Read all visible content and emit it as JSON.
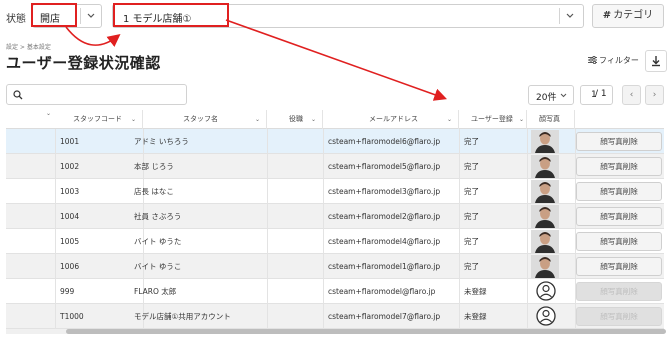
{
  "filter_bar": {
    "state_label": "状態",
    "state_value": "開店",
    "shop_value": "1 モデル店舗①",
    "category_button_icon": "#",
    "category_button_label": "カテゴリ"
  },
  "breadcrumb": "設定 > 基本設定",
  "page_title": "ユーザー登録状況確認",
  "toolbar": {
    "filter_label": "フィルター",
    "per_page_value": "20件",
    "current_page": "1",
    "total_pages": "/ 1",
    "prev_label": "‹",
    "next_label": "›"
  },
  "table": {
    "headers": {
      "staff_code": "スタッフコード",
      "staff_name": "スタッフ名",
      "role": "役職",
      "email": "メールアドレス",
      "registration": "ユーザー登録",
      "photo": "顔写真"
    },
    "delete_label": "顔写真削除",
    "rows": [
      {
        "code": "1001",
        "name": "アドミ いちろう",
        "email": "csteam+flaromodel6@flaro.jp",
        "status": "完了",
        "has_photo": true
      },
      {
        "code": "1002",
        "name": "本部 じろう",
        "email": "csteam+flaromodel5@flaro.jp",
        "status": "完了",
        "has_photo": true
      },
      {
        "code": "1003",
        "name": "店長 はなこ",
        "email": "csteam+flaromodel3@flaro.jp",
        "status": "完了",
        "has_photo": true
      },
      {
        "code": "1004",
        "name": "社員 さぶろう",
        "email": "csteam+flaromodel2@flaro.jp",
        "status": "完了",
        "has_photo": true
      },
      {
        "code": "1005",
        "name": "バイト ゆうた",
        "email": "csteam+flaromodel4@flaro.jp",
        "status": "完了",
        "has_photo": true
      },
      {
        "code": "1006",
        "name": "バイト ゆうこ",
        "email": "csteam+flaromodel1@flaro.jp",
        "status": "完了",
        "has_photo": true
      },
      {
        "code": "999",
        "name": "FLARO 太郎",
        "email": "csteam+flaromodel@flaro.jp",
        "status": "未登録",
        "has_photo": false
      },
      {
        "code": "T1000",
        "name": "モデル店舗①共用アカウント",
        "email": "csteam+flaromodel7@flaro.jp",
        "status": "未登録",
        "has_photo": false
      }
    ]
  },
  "icons": {
    "search": "search-icon",
    "filter": "filter-icon",
    "download": "download-icon",
    "chevron": "chevron-down-icon",
    "placeholder": "user-placeholder-icon"
  },
  "colors": {
    "annotation": "#e02020",
    "selected_row": "#e4f1fb",
    "striped_row": "#f1f1f1"
  }
}
